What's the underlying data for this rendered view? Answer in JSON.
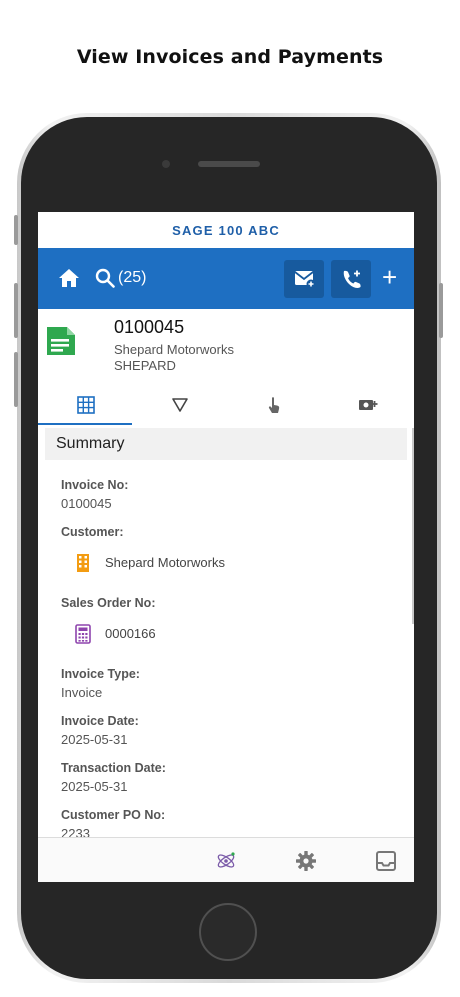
{
  "caption": "View Invoices and Payments",
  "app": {
    "title": "SAGE 100 ABC",
    "search_count": "(25)"
  },
  "record": {
    "id": "0100045",
    "customer_name": "Shepard Motorworks",
    "customer_code": "SHEPARD"
  },
  "tabs": [
    "grid-icon",
    "filter-icon",
    "touch-icon",
    "payment-icon"
  ],
  "summary": {
    "heading": "Summary",
    "invoice_no_label": "Invoice No:",
    "invoice_no": "0100045",
    "customer_label": "Customer:",
    "customer": "Shepard Motorworks",
    "sales_order_label": "Sales Order No:",
    "sales_order": "0000166",
    "invoice_type_label": "Invoice Type:",
    "invoice_type": "Invoice",
    "invoice_date_label": "Invoice Date:",
    "invoice_date": "2025-05-31",
    "transaction_date_label": "Transaction Date:",
    "transaction_date": "2025-05-31",
    "customer_po_label": "Customer PO No:",
    "customer_po": "2233"
  },
  "colors": {
    "brand_blue": "#1e6fc2",
    "doc_green": "#2fa84f",
    "building_orange": "#f39c12",
    "calc_purple": "#8e44ad"
  }
}
